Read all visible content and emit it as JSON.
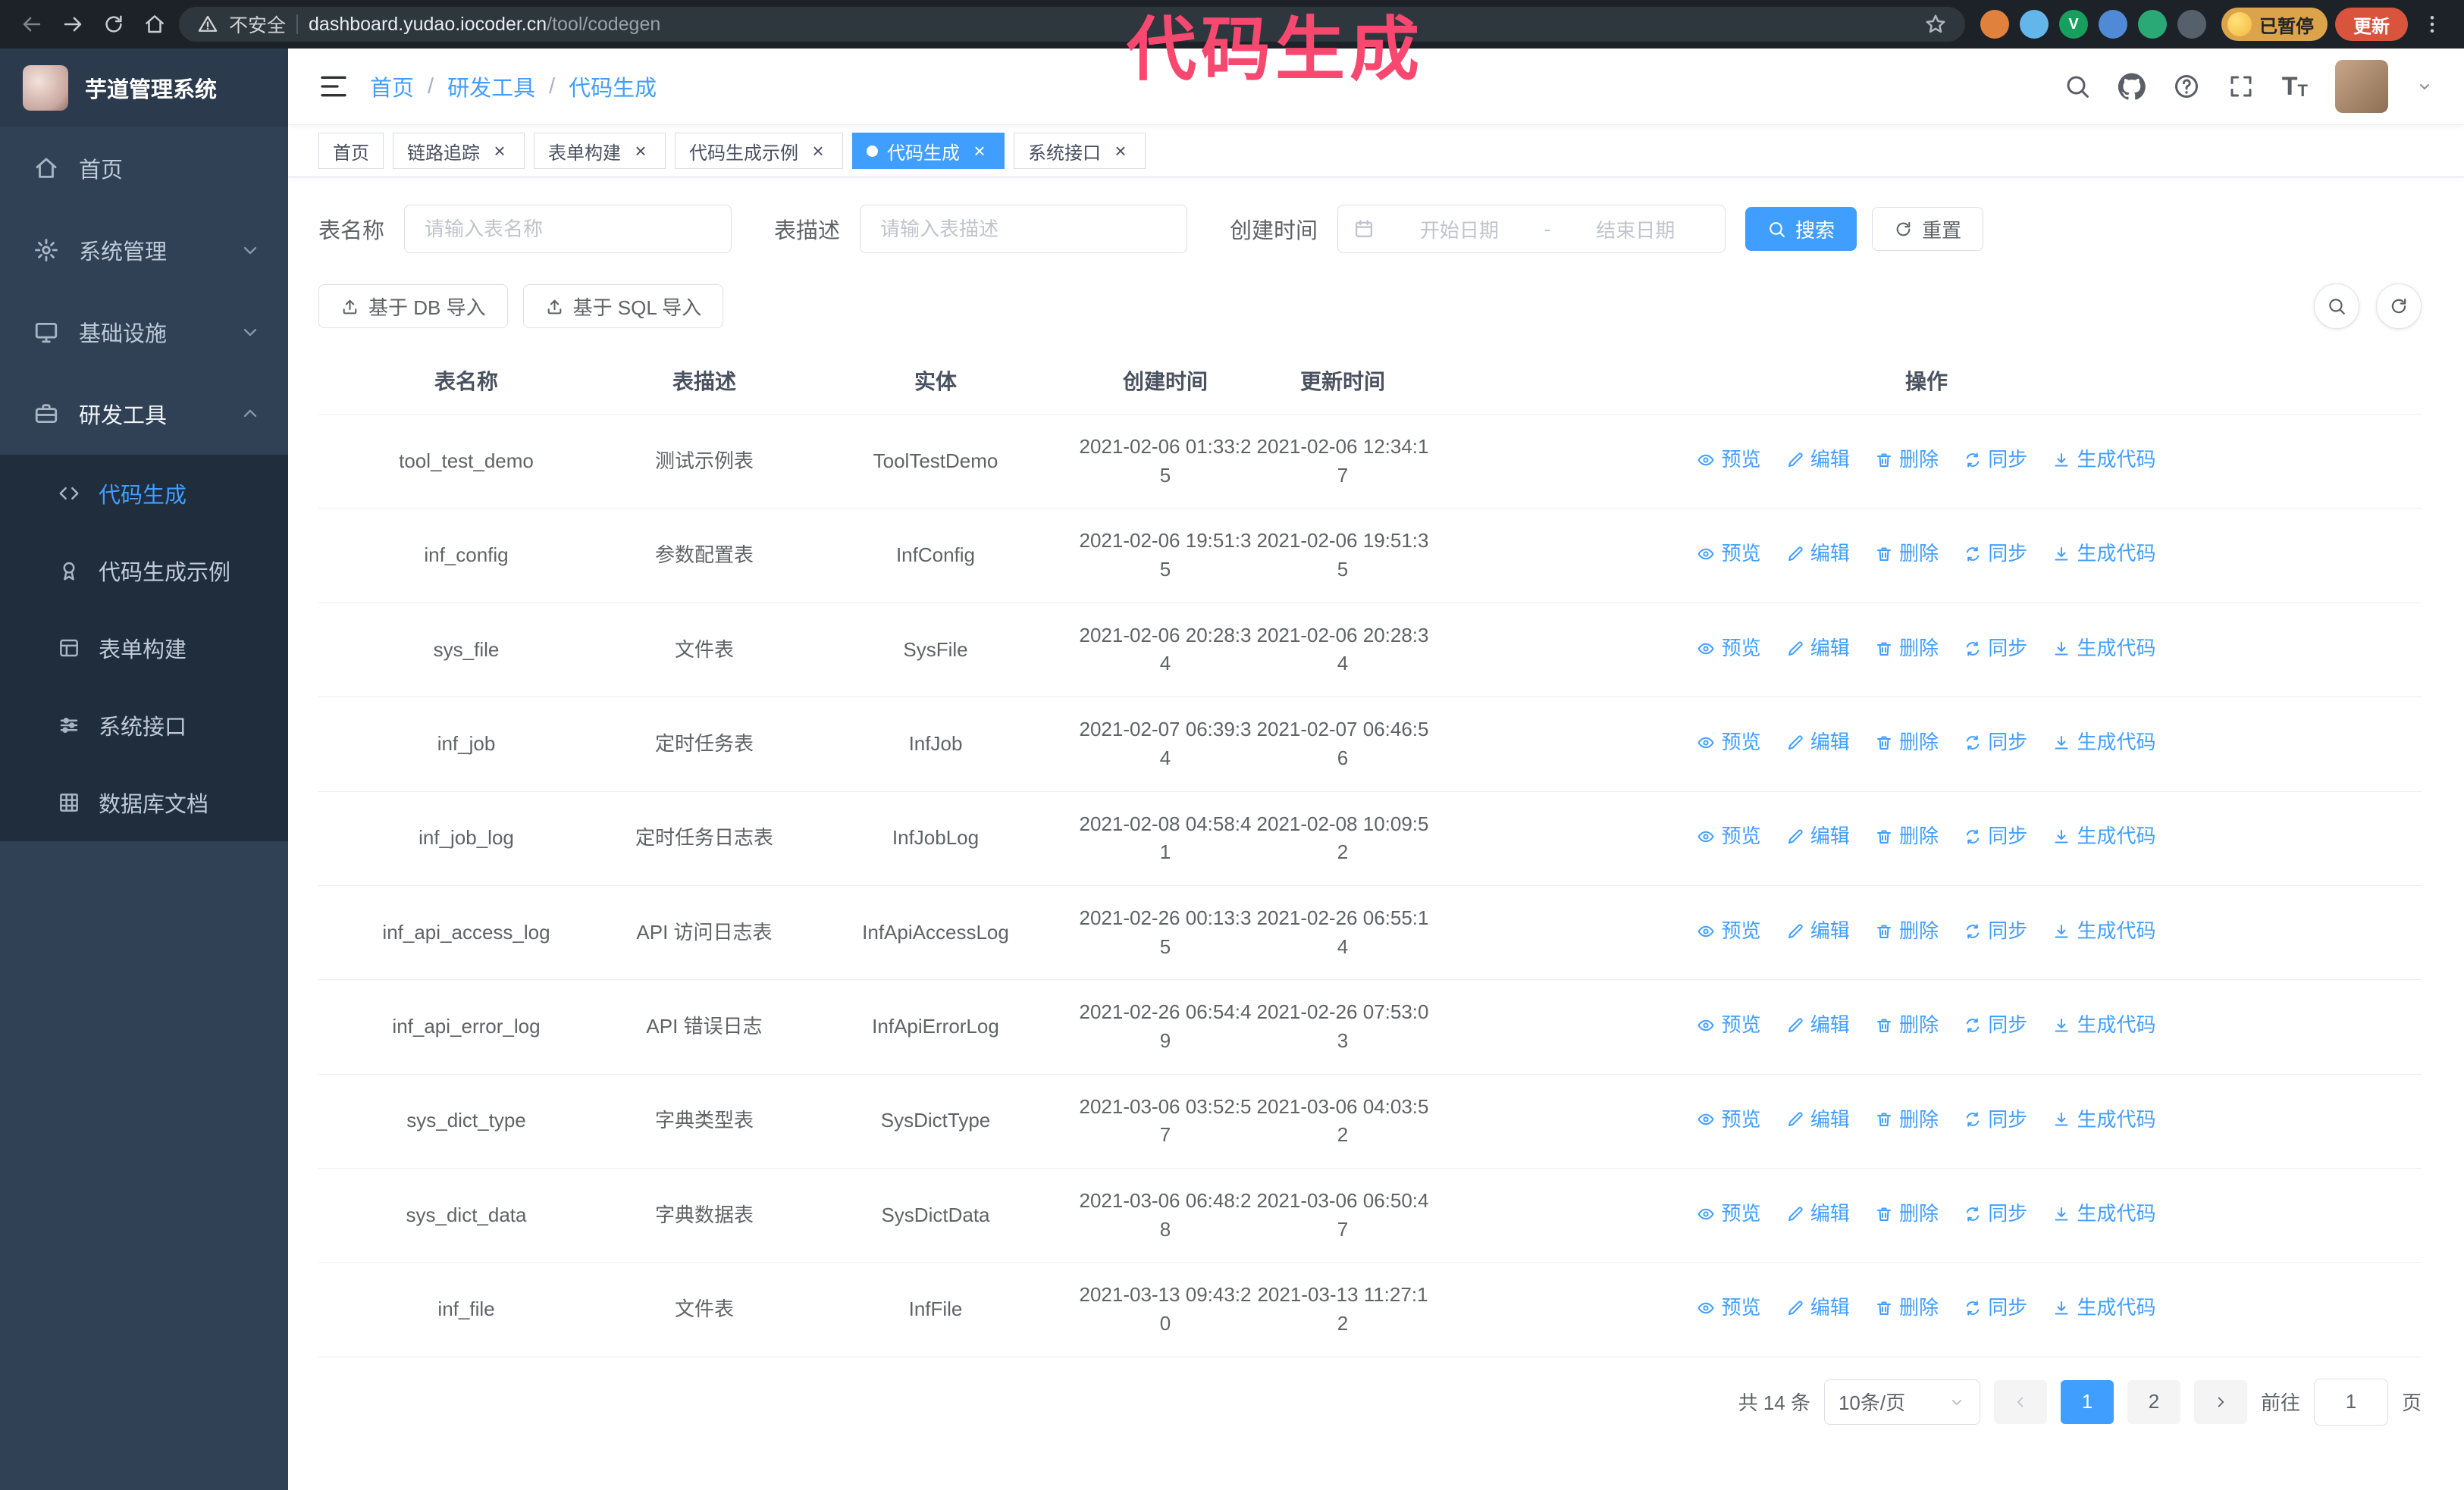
{
  "browser": {
    "security_label": "不安全",
    "url_domain": "dashboard.yudao.iocoder.cn",
    "url_path": "/tool/codegen",
    "paused_badge": "已暂停",
    "update_button": "更新",
    "extensions": [
      {
        "glyph": "",
        "css": "background:#e0823d"
      },
      {
        "glyph": "",
        "css": "background:#62b6e9"
      },
      {
        "glyph": "V",
        "css": "background:#17a05d"
      },
      {
        "glyph": "",
        "css": "background:#5089d6"
      },
      {
        "glyph": "",
        "css": "background:#2aa876"
      },
      {
        "glyph": "",
        "css": "background:#56606b"
      }
    ]
  },
  "annotation": {
    "text": "代码生成"
  },
  "icons": {
    "close": "×",
    "breadcrumb_separator": "/",
    "font_large": "T",
    "font_small": "T"
  },
  "sidebar": {
    "logo_title": "芋道管理系统",
    "items": [
      {
        "label": "首页",
        "icon": "home-icon"
      },
      {
        "label": "系统管理",
        "icon": "gear-icon"
      },
      {
        "label": "基础设施",
        "icon": "infrastructure-icon"
      },
      {
        "label": "研发工具",
        "icon": "devtools-icon",
        "expanded": true
      }
    ],
    "submenu": [
      {
        "label": "代码生成",
        "icon": "code-icon",
        "active": true
      },
      {
        "label": "代码生成示例",
        "icon": "example-icon"
      },
      {
        "label": "表单构建",
        "icon": "form-builder-icon"
      },
      {
        "label": "系统接口",
        "icon": "api-icon"
      },
      {
        "label": "数据库文档",
        "icon": "database-doc-icon"
      }
    ]
  },
  "header": {
    "breadcrumb": [
      "首页",
      "研发工具",
      "代码生成"
    ]
  },
  "tabs": [
    {
      "label": "首页",
      "closable": false,
      "active": false
    },
    {
      "label": "链路追踪",
      "closable": true,
      "active": false
    },
    {
      "label": "表单构建",
      "closable": true,
      "active": false
    },
    {
      "label": "代码生成示例",
      "closable": true,
      "active": false
    },
    {
      "label": "代码生成",
      "closable": true,
      "active": true
    },
    {
      "label": "系统接口",
      "closable": true,
      "active": false
    }
  ],
  "filters": {
    "table_name_label": "表名称",
    "table_name_placeholder": "请输入表名称",
    "table_desc_label": "表描述",
    "table_desc_placeholder": "请输入表描述",
    "create_time_label": "创建时间",
    "start_date_placeholder": "开始日期",
    "range_separator": "-",
    "end_date_placeholder": "结束日期",
    "search_button": "搜索",
    "reset_button": "重置"
  },
  "toolbar": {
    "import_db_button": "基于 DB 导入",
    "import_sql_button": "基于 SQL 导入"
  },
  "table": {
    "columns": [
      "表名称",
      "表描述",
      "实体",
      "创建时间",
      "更新时间",
      "操作"
    ],
    "actions": [
      "预览",
      "编辑",
      "删除",
      "同步",
      "生成代码"
    ],
    "rows": [
      {
        "name": "tool_test_demo",
        "desc": "测试示例表",
        "entity": "ToolTestDemo",
        "created": "2021-02-06 01:33:25",
        "updated": "2021-02-06 12:34:17"
      },
      {
        "name": "inf_config",
        "desc": "参数配置表",
        "entity": "InfConfig",
        "created": "2021-02-06 19:51:35",
        "updated": "2021-02-06 19:51:35"
      },
      {
        "name": "sys_file",
        "desc": "文件表",
        "entity": "SysFile",
        "created": "2021-02-06 20:28:34",
        "updated": "2021-02-06 20:28:34"
      },
      {
        "name": "inf_job",
        "desc": "定时任务表",
        "entity": "InfJob",
        "created": "2021-02-07 06:39:34",
        "updated": "2021-02-07 06:46:56"
      },
      {
        "name": "inf_job_log",
        "desc": "定时任务日志表",
        "entity": "InfJobLog",
        "created": "2021-02-08 04:58:41",
        "updated": "2021-02-08 10:09:52"
      },
      {
        "name": "inf_api_access_log",
        "desc": "API 访问日志表",
        "entity": "InfApiAccessLog",
        "created": "2021-02-26 00:13:35",
        "updated": "2021-02-26 06:55:14"
      },
      {
        "name": "inf_api_error_log",
        "desc": "API 错误日志",
        "entity": "InfApiErrorLog",
        "created": "2021-02-26 06:54:49",
        "updated": "2021-02-26 07:53:03"
      },
      {
        "name": "sys_dict_type",
        "desc": "字典类型表",
        "entity": "SysDictType",
        "created": "2021-03-06 03:52:57",
        "updated": "2021-03-06 04:03:52"
      },
      {
        "name": "sys_dict_data",
        "desc": "字典数据表",
        "entity": "SysDictData",
        "created": "2021-03-06 06:48:28",
        "updated": "2021-03-06 06:50:47"
      },
      {
        "name": "inf_file",
        "desc": "文件表",
        "entity": "InfFile",
        "created": "2021-03-13 09:43:20",
        "updated": "2021-03-13 11:27:12"
      }
    ]
  },
  "pagination": {
    "total_text": "共 14 条",
    "page_size": "10条/页",
    "pages": [
      "1",
      "2"
    ],
    "active_page": "1",
    "goto_prefix": "前往",
    "goto_value": "1",
    "goto_suffix": "页"
  },
  "colors": {
    "accent": "#409eff",
    "sidebar_bg": "#304156",
    "submenu_bg": "#1f2d3d",
    "annotation": "#f9486f",
    "update_button": "#d9543d",
    "paused_badge": "#dca44a"
  }
}
